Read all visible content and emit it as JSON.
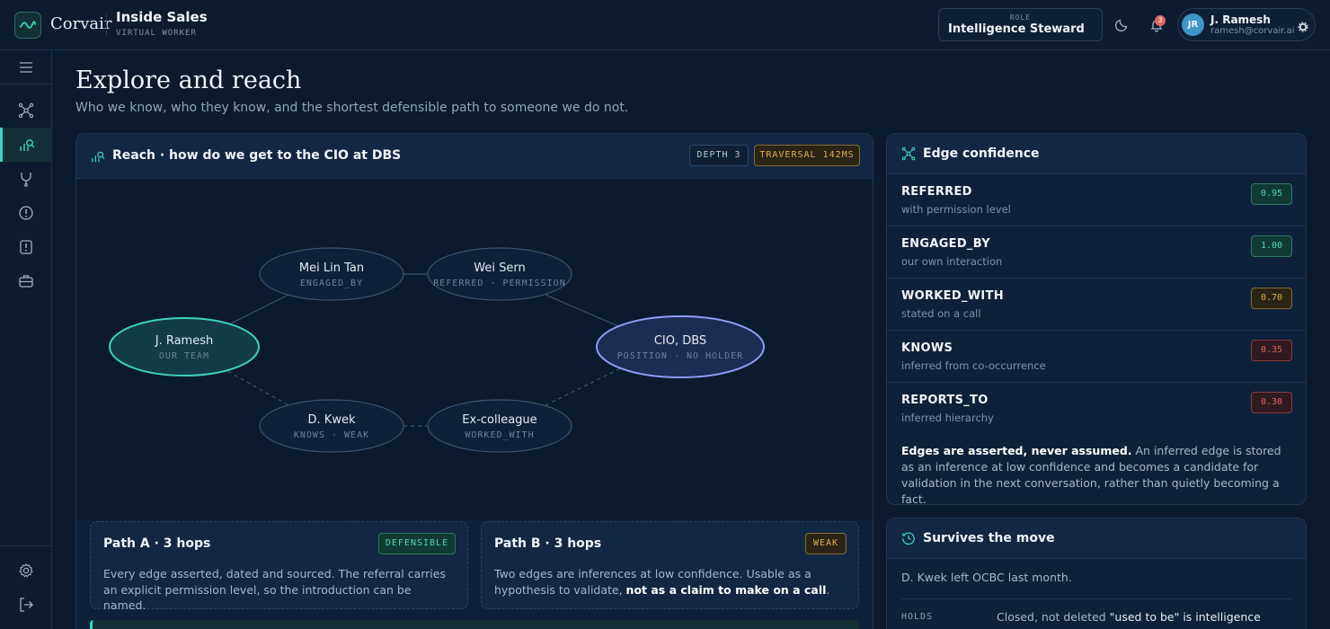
{
  "app": {
    "brand": "Corvair",
    "title": "Inside Sales",
    "subtitle": "VIRTUAL WORKER"
  },
  "header": {
    "role_label": "ROLE",
    "role_value": "Intelligence Steward",
    "notification_count": "3",
    "user_initials": "JR",
    "user_name": "J. Ramesh",
    "user_email": "ramesh@corvair.ai"
  },
  "sidebar": {
    "items": [
      {
        "name": "menu",
        "icon": "menu-icon"
      },
      {
        "name": "network",
        "icon": "network-icon"
      },
      {
        "name": "reach",
        "icon": "reach-chart-icon",
        "active": true
      },
      {
        "name": "fork",
        "icon": "fork-icon"
      },
      {
        "name": "alerts",
        "icon": "alert-circle-icon"
      },
      {
        "name": "flags",
        "icon": "alert-square-icon"
      },
      {
        "name": "briefcase",
        "icon": "briefcase-icon"
      },
      {
        "name": "settings",
        "icon": "gear-icon"
      },
      {
        "name": "logout",
        "icon": "logout-icon"
      }
    ]
  },
  "page": {
    "title": "Explore and reach",
    "subtitle": "Who we know, who they know, and the shortest defensible path to someone we do not."
  },
  "reach": {
    "title": "Reach · how do we get to the CIO at DBS",
    "depth": "DEPTH 3",
    "traversal": "TRAVERSAL 142MS",
    "nodes": [
      {
        "name": "J. Ramesh",
        "tag": "OUR TEAM"
      },
      {
        "name": "Mei Lin Tan",
        "tag": "ENGAGED_BY"
      },
      {
        "name": "Wei Sern",
        "tag": "REFERRED · PERMISSION"
      },
      {
        "name": "CIO, DBS",
        "tag": "POSITION · NO HOLDER"
      },
      {
        "name": "D. Kwek",
        "tag": "KNOWS · WEAK"
      },
      {
        "name": "Ex-colleague",
        "tag": "WORKED_WITH"
      }
    ],
    "paths": [
      {
        "title": "Path A · 3 hops",
        "badge": "DEFENSIBLE",
        "desc": "Every edge asserted, dated and sourced. The referral carries an explicit permission level, so the introduction can be named."
      },
      {
        "title": "Path B · 3 hops",
        "badge": "WEAK",
        "desc_plain": "Two edges are inferences at low confidence. Usable as a hypothesis to validate, ",
        "desc_bold": "not as a claim to make on a call",
        "desc_end": "."
      }
    ]
  },
  "edges": {
    "title": "Edge confidence",
    "rows": [
      {
        "name": "REFERRED",
        "desc": "with permission level",
        "score": "0.95",
        "level": "high"
      },
      {
        "name": "ENGAGED_BY",
        "desc": "our own interaction",
        "score": "1.00",
        "level": "high"
      },
      {
        "name": "WORKED_WITH",
        "desc": "stated on a call",
        "score": "0.70",
        "level": "mid"
      },
      {
        "name": "KNOWS",
        "desc": "inferred from co-occurrence",
        "score": "0.35",
        "level": "low"
      },
      {
        "name": "REPORTS_TO",
        "desc": "inferred hierarchy",
        "score": "0.30",
        "level": "low"
      }
    ],
    "note_bold": "Edges are asserted, never assumed.",
    "note": " An inferred edge is stored as an inference at low confidence and becomes a candidate for validation in the next conversation, rather than quietly becoming a fact."
  },
  "move": {
    "title": "Survives the move",
    "text": "D. Kwek left OCBC last month.",
    "holds_label": "HOLDS",
    "holds_value_a": "Closed, not deleted ",
    "holds_value_b": "\"used to be\" is intelligence"
  },
  "colors": {
    "accent": "#3ed3c3",
    "target": "#8f9cf5",
    "high": "#3ed3a0",
    "mid": "#d9a441",
    "low": "#e0665a"
  }
}
